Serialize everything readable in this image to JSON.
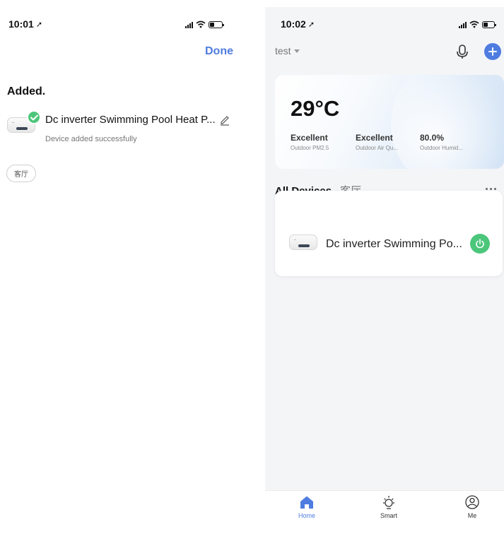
{
  "left_screen": {
    "status": {
      "time": "10:01",
      "location_glyph": "➚"
    },
    "done_label": "Done",
    "title": "Added.",
    "device": {
      "name": "Dc inverter Swimming Pool Heat P...",
      "status": "Device added successfully"
    },
    "room_chip": "客厅"
  },
  "right_screen": {
    "status": {
      "time": "10:02",
      "location_glyph": "➚"
    },
    "home_name": "test",
    "weather": {
      "temperature": "29°C",
      "stats": [
        {
          "value": "Excellent",
          "label": "Outdoor PM2.5"
        },
        {
          "value": "Excellent",
          "label": "Outdoor Air Qu..."
        },
        {
          "value": "80.0%",
          "label": "Outdoor Humid..."
        }
      ]
    },
    "tabs": {
      "all": "All Devices",
      "room": "客厅"
    },
    "device": {
      "name": "Dc inverter Swimming Po..."
    },
    "tabbar": [
      {
        "label": "Home",
        "icon": "home-icon",
        "active": true
      },
      {
        "label": "Smart",
        "icon": "sun-icon",
        "active": false
      },
      {
        "label": "Me",
        "icon": "profile-icon",
        "active": false
      }
    ]
  },
  "colors": {
    "accent": "#4f7ce0",
    "success": "#4cc67a",
    "background_right": "#f4f5f7"
  }
}
